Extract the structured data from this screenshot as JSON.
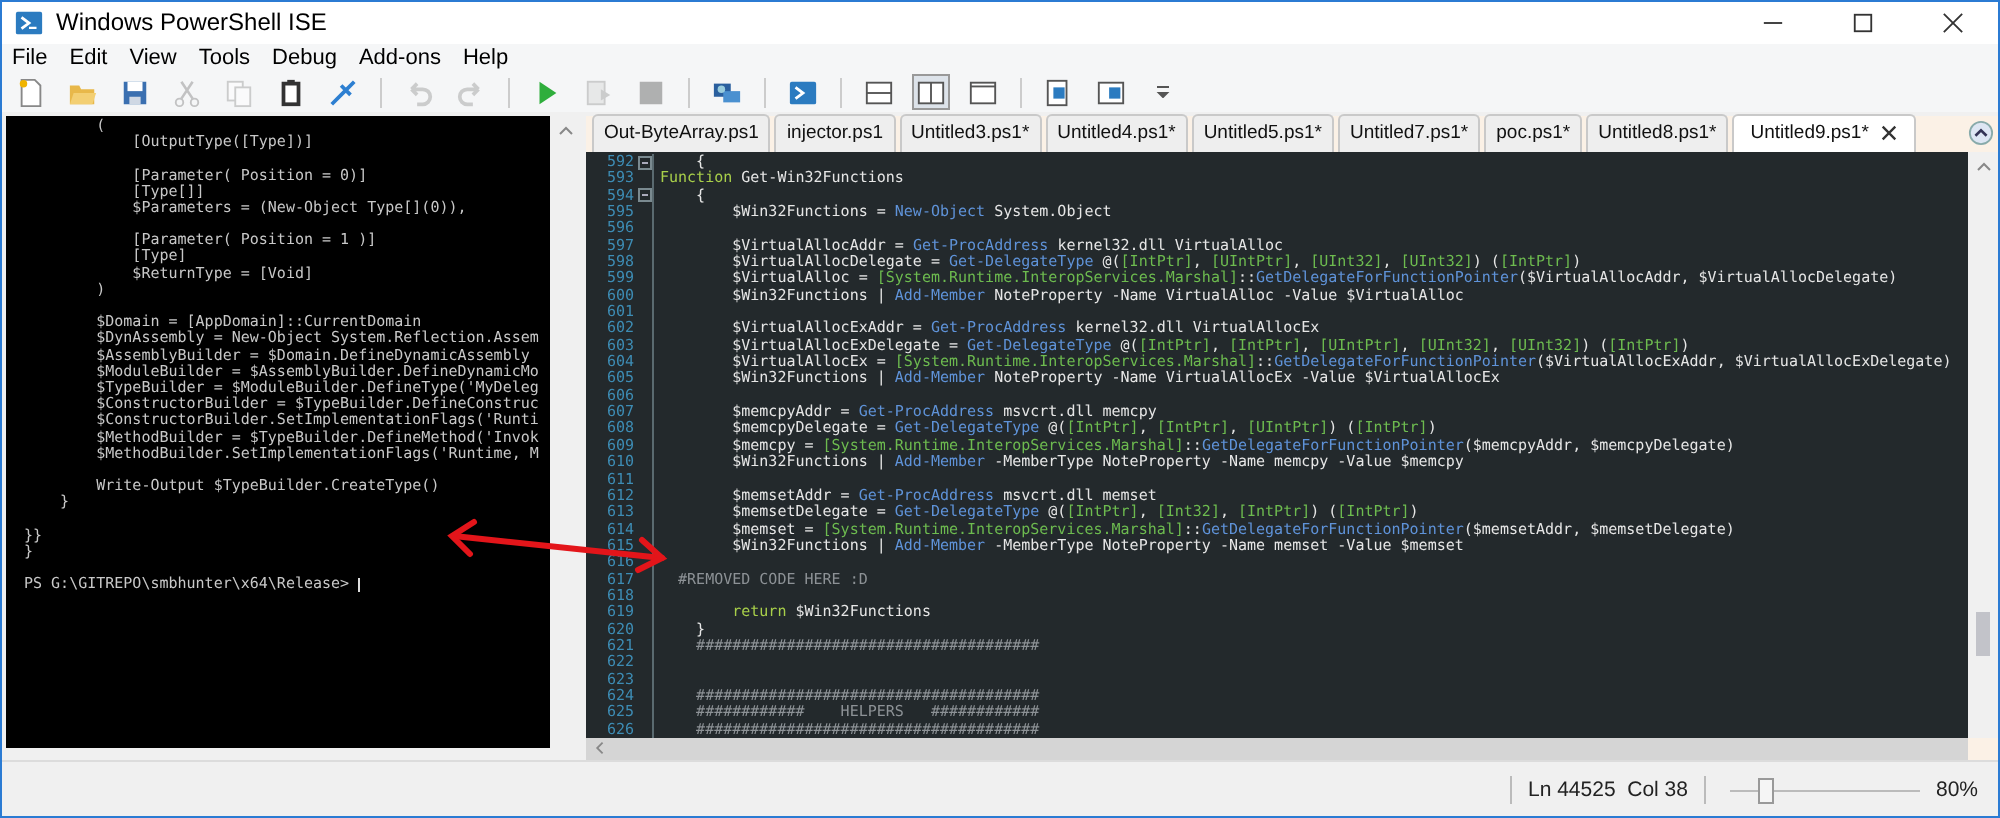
{
  "window": {
    "title": "Windows PowerShell ISE"
  },
  "menu": [
    "File",
    "Edit",
    "View",
    "Tools",
    "Debug",
    "Add-ons",
    "Help"
  ],
  "toolbar": [
    [
      {
        "kind": "new",
        "disabled": false,
        "selected": false
      },
      {
        "kind": "open",
        "disabled": false,
        "selected": false
      },
      {
        "kind": "save",
        "disabled": false,
        "selected": false
      },
      {
        "kind": "cut",
        "disabled": true,
        "selected": false
      },
      {
        "kind": "copy",
        "disabled": true,
        "selected": false
      },
      {
        "kind": "paste",
        "disabled": false,
        "selected": false
      },
      {
        "kind": "clear",
        "disabled": false,
        "selected": false
      }
    ],
    [
      {
        "kind": "undo",
        "disabled": true,
        "selected": false
      },
      {
        "kind": "redo",
        "disabled": true,
        "selected": false
      }
    ],
    [
      {
        "kind": "run",
        "disabled": false,
        "selected": false
      },
      {
        "kind": "run-selection",
        "disabled": true,
        "selected": false
      },
      {
        "kind": "stop",
        "disabled": true,
        "selected": false
      }
    ],
    [
      {
        "kind": "remote",
        "disabled": false,
        "selected": false
      }
    ],
    [
      {
        "kind": "console",
        "disabled": false,
        "selected": false
      }
    ],
    [
      {
        "kind": "pane-top",
        "disabled": false,
        "selected": false
      },
      {
        "kind": "pane-right",
        "disabled": false,
        "selected": true
      },
      {
        "kind": "pane-max",
        "disabled": false,
        "selected": false
      }
    ],
    [
      {
        "kind": "script-pane",
        "disabled": false,
        "selected": false
      },
      {
        "kind": "command-pane",
        "disabled": false,
        "selected": false
      },
      {
        "kind": "dropdown",
        "disabled": false,
        "selected": false
      }
    ]
  ],
  "console": {
    "lines": [
      {
        "text": "        (",
        "gap": false
      },
      {
        "text": "            [OutputType([Type])]",
        "gap": false
      },
      {
        "text": "            [Parameter( Position = 0)]",
        "gap": true
      },
      {
        "text": "            [Type[]]",
        "gap": false
      },
      {
        "text": "            $Parameters = (New-Object Type[](0)),",
        "gap": false
      },
      {
        "text": "            [Parameter( Position = 1 )]",
        "gap": true
      },
      {
        "text": "            [Type]",
        "gap": false
      },
      {
        "text": "            $ReturnType = [Void]",
        "gap": false
      },
      {
        "text": "        )",
        "gap": false
      },
      {
        "text": "        $Domain = [AppDomain]::CurrentDomain",
        "gap": true
      },
      {
        "text": "        $DynAssembly = New-Object System.Reflection.Assem",
        "gap": false
      },
      {
        "text": "        $AssemblyBuilder = $Domain.DefineDynamicAssembly",
        "gap": false
      },
      {
        "text": "        $ModuleBuilder = $AssemblyBuilder.DefineDynamicMo",
        "gap": false
      },
      {
        "text": "        $TypeBuilder = $ModuleBuilder.DefineType('MyDeleg",
        "gap": false
      },
      {
        "text": "        $ConstructorBuilder = $TypeBuilder.DefineConstruc",
        "gap": false
      },
      {
        "text": "        $ConstructorBuilder.SetImplementationFlags('Runti",
        "gap": false
      },
      {
        "text": "        $MethodBuilder = $TypeBuilder.DefineMethod('Invok",
        "gap": false
      },
      {
        "text": "        $MethodBuilder.SetImplementationFlags('Runtime, M",
        "gap": false
      },
      {
        "text": "        Write-Output $TypeBuilder.CreateType()",
        "gap": true
      },
      {
        "text": "    }",
        "gap": false
      },
      {
        "text": "}}",
        "gap": true
      },
      {
        "text": "}",
        "gap": false
      }
    ],
    "prompt": "PS G:\\GITREPO\\smbhunter\\x64\\Release>"
  },
  "tabs": [
    {
      "label": "Out-ByteArray.ps1",
      "selected": false
    },
    {
      "label": "injector.ps1",
      "selected": false
    },
    {
      "label": "Untitled3.ps1*",
      "selected": false
    },
    {
      "label": "Untitled4.ps1*",
      "selected": false
    },
    {
      "label": "Untitled5.ps1*",
      "selected": false
    },
    {
      "label": "Untitled7.ps1*",
      "selected": false
    },
    {
      "label": "poc.ps1*",
      "selected": false
    },
    {
      "label": "Untitled8.ps1*",
      "selected": false
    },
    {
      "label": "Untitled9.ps1*",
      "selected": true
    }
  ],
  "editor": {
    "lines": [
      {
        "n": "592",
        "fold": true,
        "code": [
          {
            "kind": "p",
            "text": "    {"
          }
        ]
      },
      {
        "n": "593",
        "fold": false,
        "code": [
          {
            "kind": "k",
            "text": "Function "
          },
          {
            "kind": "p",
            "text": "Get-Win32Functions"
          }
        ]
      },
      {
        "n": "594",
        "fold": true,
        "code": [
          {
            "kind": "p",
            "text": "    {"
          }
        ]
      },
      {
        "n": "595",
        "fold": false,
        "code": [
          {
            "kind": "p",
            "text": "        $Win32Functions = "
          },
          {
            "kind": "c",
            "text": "New-Object "
          },
          {
            "kind": "p",
            "text": "System.Object"
          }
        ]
      },
      {
        "n": "596",
        "fold": false
      },
      {
        "n": "597",
        "fold": false,
        "code": [
          {
            "kind": "p",
            "text": "        $VirtualAllocAddr = "
          },
          {
            "kind": "c",
            "text": "Get-ProcAddress "
          },
          {
            "kind": "p",
            "text": "kernel32.dll VirtualAlloc"
          }
        ]
      },
      {
        "n": "598",
        "fold": false,
        "code": [
          {
            "kind": "p",
            "text": "        $VirtualAllocDelegate = "
          },
          {
            "kind": "c",
            "text": "Get-DelegateType "
          },
          {
            "kind": "p",
            "text": "@("
          },
          {
            "kind": "t",
            "text": "[IntPtr]"
          },
          {
            "kind": "p",
            "text": ", "
          },
          {
            "kind": "t",
            "text": "[UIntPtr]"
          },
          {
            "kind": "p",
            "text": ", "
          },
          {
            "kind": "t",
            "text": "[UInt32]"
          },
          {
            "kind": "p",
            "text": ", "
          },
          {
            "kind": "t",
            "text": "[UInt32]"
          },
          {
            "kind": "p",
            "text": ") ("
          },
          {
            "kind": "t",
            "text": "[IntPtr]"
          },
          {
            "kind": "p",
            "text": ")"
          }
        ]
      },
      {
        "n": "599",
        "fold": false,
        "code": [
          {
            "kind": "p",
            "text": "        $VirtualAlloc = "
          },
          {
            "kind": "t",
            "text": "[System.Runtime.InteropServices.Marshal]"
          },
          {
            "kind": "p",
            "text": "::"
          },
          {
            "kind": "c",
            "text": "GetDelegateForFunctionPointer"
          },
          {
            "kind": "p",
            "text": "($VirtualAllocAddr, $VirtualAllocDelegate)"
          }
        ]
      },
      {
        "n": "600",
        "fold": false,
        "code": [
          {
            "kind": "p",
            "text": "        $Win32Functions | "
          },
          {
            "kind": "c",
            "text": "Add-Member "
          },
          {
            "kind": "p",
            "text": "NoteProperty -Name VirtualAlloc -Value $VirtualAlloc"
          }
        ]
      },
      {
        "n": "601",
        "fold": false
      },
      {
        "n": "602",
        "fold": false,
        "code": [
          {
            "kind": "p",
            "text": "        $VirtualAllocExAddr = "
          },
          {
            "kind": "c",
            "text": "Get-ProcAddress "
          },
          {
            "kind": "p",
            "text": "kernel32.dll VirtualAllocEx"
          }
        ]
      },
      {
        "n": "603",
        "fold": false,
        "code": [
          {
            "kind": "p",
            "text": "        $VirtualAllocExDelegate = "
          },
          {
            "kind": "c",
            "text": "Get-DelegateType "
          },
          {
            "kind": "p",
            "text": "@("
          },
          {
            "kind": "t",
            "text": "[IntPtr]"
          },
          {
            "kind": "p",
            "text": ", "
          },
          {
            "kind": "t",
            "text": "[IntPtr]"
          },
          {
            "kind": "p",
            "text": ", "
          },
          {
            "kind": "t",
            "text": "[UIntPtr]"
          },
          {
            "kind": "p",
            "text": ", "
          },
          {
            "kind": "t",
            "text": "[UInt32]"
          },
          {
            "kind": "p",
            "text": ", "
          },
          {
            "kind": "t",
            "text": "[UInt32]"
          },
          {
            "kind": "p",
            "text": ") ("
          },
          {
            "kind": "t",
            "text": "[IntPtr]"
          },
          {
            "kind": "p",
            "text": ")"
          }
        ]
      },
      {
        "n": "604",
        "fold": false,
        "code": [
          {
            "kind": "p",
            "text": "        $VirtualAllocEx = "
          },
          {
            "kind": "t",
            "text": "[System.Runtime.InteropServices.Marshal]"
          },
          {
            "kind": "p",
            "text": "::"
          },
          {
            "kind": "c",
            "text": "GetDelegateForFunctionPointer"
          },
          {
            "kind": "p",
            "text": "($VirtualAllocExAddr, $VirtualAllocExDelegate)"
          }
        ]
      },
      {
        "n": "605",
        "fold": false,
        "code": [
          {
            "kind": "p",
            "text": "        $Win32Functions | "
          },
          {
            "kind": "c",
            "text": "Add-Member "
          },
          {
            "kind": "p",
            "text": "NoteProperty -Name VirtualAllocEx -Value $VirtualAllocEx"
          }
        ]
      },
      {
        "n": "606",
        "fold": false
      },
      {
        "n": "607",
        "fold": false,
        "code": [
          {
            "kind": "p",
            "text": "        $memcpyAddr = "
          },
          {
            "kind": "c",
            "text": "Get-ProcAddress "
          },
          {
            "kind": "p",
            "text": "msvcrt.dll memcpy"
          }
        ]
      },
      {
        "n": "608",
        "fold": false,
        "code": [
          {
            "kind": "p",
            "text": "        $memcpyDelegate = "
          },
          {
            "kind": "c",
            "text": "Get-DelegateType "
          },
          {
            "kind": "p",
            "text": "@("
          },
          {
            "kind": "t",
            "text": "[IntPtr]"
          },
          {
            "kind": "p",
            "text": ", "
          },
          {
            "kind": "t",
            "text": "[IntPtr]"
          },
          {
            "kind": "p",
            "text": ", "
          },
          {
            "kind": "t",
            "text": "[UIntPtr]"
          },
          {
            "kind": "p",
            "text": ") ("
          },
          {
            "kind": "t",
            "text": "[IntPtr]"
          },
          {
            "kind": "p",
            "text": ")"
          }
        ]
      },
      {
        "n": "609",
        "fold": false,
        "code": [
          {
            "kind": "p",
            "text": "        $memcpy = "
          },
          {
            "kind": "t",
            "text": "[System.Runtime.InteropServices.Marshal]"
          },
          {
            "kind": "p",
            "text": "::"
          },
          {
            "kind": "c",
            "text": "GetDelegateForFunctionPointer"
          },
          {
            "kind": "p",
            "text": "($memcpyAddr, $memcpyDelegate)"
          }
        ]
      },
      {
        "n": "610",
        "fold": false,
        "code": [
          {
            "kind": "p",
            "text": "        $Win32Functions | "
          },
          {
            "kind": "c",
            "text": "Add-Member "
          },
          {
            "kind": "p",
            "text": "-MemberType NoteProperty -Name memcpy -Value $memcpy"
          }
        ]
      },
      {
        "n": "611",
        "fold": false
      },
      {
        "n": "612",
        "fold": false,
        "code": [
          {
            "kind": "p",
            "text": "        $memsetAddr = "
          },
          {
            "kind": "c",
            "text": "Get-ProcAddress "
          },
          {
            "kind": "p",
            "text": "msvcrt.dll memset"
          }
        ]
      },
      {
        "n": "613",
        "fold": false,
        "code": [
          {
            "kind": "p",
            "text": "        $memsetDelegate = "
          },
          {
            "kind": "c",
            "text": "Get-DelegateType "
          },
          {
            "kind": "p",
            "text": "@("
          },
          {
            "kind": "t",
            "text": "[IntPtr]"
          },
          {
            "kind": "p",
            "text": ", "
          },
          {
            "kind": "t",
            "text": "[Int32]"
          },
          {
            "kind": "p",
            "text": ", "
          },
          {
            "kind": "t",
            "text": "[IntPtr]"
          },
          {
            "kind": "p",
            "text": ") ("
          },
          {
            "kind": "t",
            "text": "[IntPtr]"
          },
          {
            "kind": "p",
            "text": ")"
          }
        ]
      },
      {
        "n": "614",
        "fold": false,
        "code": [
          {
            "kind": "p",
            "text": "        $memset = "
          },
          {
            "kind": "t",
            "text": "[System.Runtime.InteropServices.Marshal]"
          },
          {
            "kind": "p",
            "text": "::"
          },
          {
            "kind": "c",
            "text": "GetDelegateForFunctionPointer"
          },
          {
            "kind": "p",
            "text": "($memsetAddr, $memsetDelegate)"
          }
        ]
      },
      {
        "n": "615",
        "fold": false,
        "code": [
          {
            "kind": "p",
            "text": "        $Win32Functions | "
          },
          {
            "kind": "c",
            "text": "Add-Member "
          },
          {
            "kind": "p",
            "text": "-MemberType NoteProperty -Name memset -Value $memset"
          }
        ]
      },
      {
        "n": "616",
        "fold": false
      },
      {
        "n": "617",
        "fold": false,
        "code": [
          {
            "kind": "m",
            "text": "  #REMOVED CODE HERE :D"
          }
        ]
      },
      {
        "n": "618",
        "fold": false
      },
      {
        "n": "619",
        "fold": false,
        "code": [
          {
            "kind": "k",
            "text": "        return "
          },
          {
            "kind": "p",
            "text": "$Win32Functions"
          }
        ]
      },
      {
        "n": "620",
        "fold": false,
        "code": [
          {
            "kind": "p",
            "text": "    }"
          }
        ]
      },
      {
        "n": "621",
        "fold": false,
        "code": [
          {
            "kind": "m",
            "text": "    ######################################"
          }
        ]
      },
      {
        "n": "622",
        "fold": false
      },
      {
        "n": "623",
        "fold": false
      },
      {
        "n": "624",
        "fold": false,
        "code": [
          {
            "kind": "m",
            "text": "    ######################################"
          }
        ]
      },
      {
        "n": "625",
        "fold": false,
        "code": [
          {
            "kind": "m",
            "text": "    ############    HELPERS   ############"
          }
        ]
      },
      {
        "n": "626",
        "fold": false,
        "code": [
          {
            "kind": "m",
            "text": "    ######################################"
          }
        ]
      }
    ]
  },
  "status_bar": {
    "position": "Ln 44525  Col 38",
    "zoom": {
      "level": 0.18,
      "reading": "80%"
    }
  }
}
